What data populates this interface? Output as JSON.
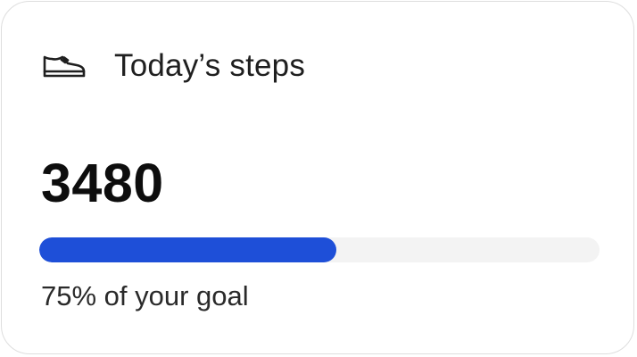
{
  "card": {
    "title": "Today’s steps",
    "icon": "shoe-icon",
    "steps": "3480",
    "progress_fraction": 0.53,
    "progress_color": "#1e4fd8",
    "caption": "75% of your goal"
  }
}
